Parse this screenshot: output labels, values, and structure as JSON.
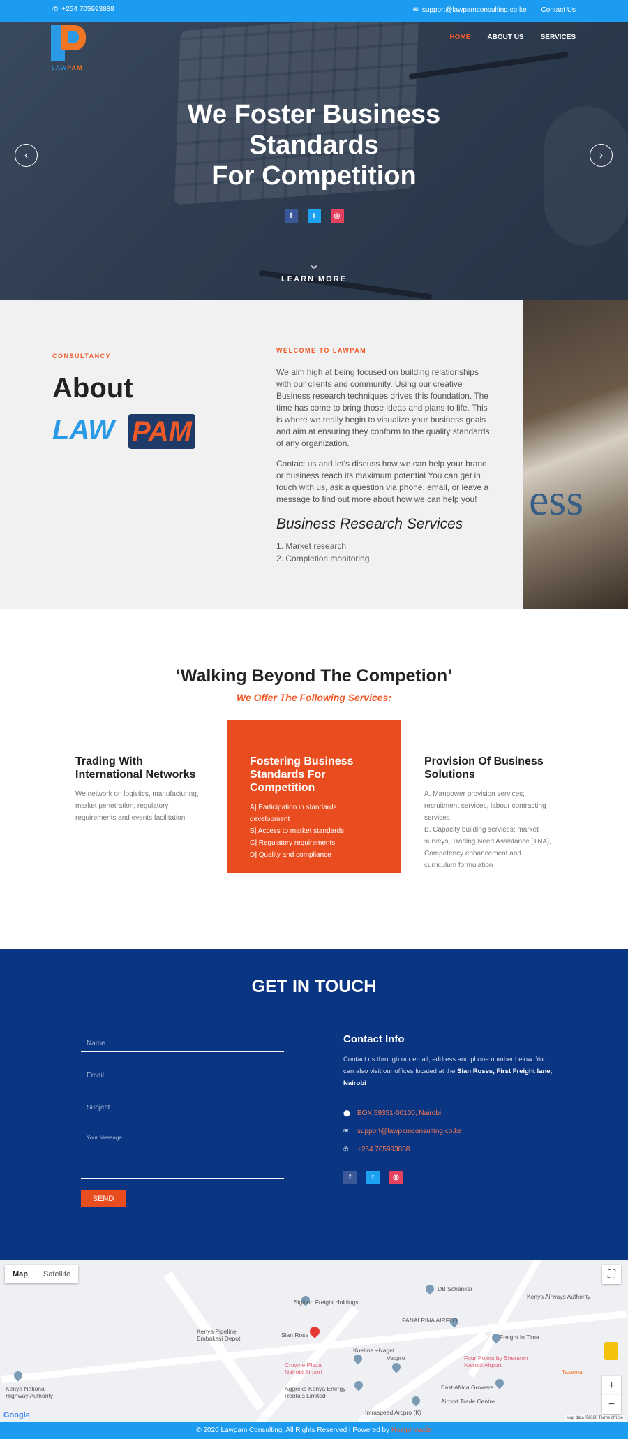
{
  "topbar": {
    "phone": "+254 705993888",
    "email": "support@lawpamconsulting.co.ke",
    "contact_link": "Contact Us"
  },
  "brand": {
    "logo_law": "LAW",
    "logo_pam": "PAM"
  },
  "nav": {
    "home": "HOME",
    "about": "ABOUT US",
    "services": "SERVICES"
  },
  "hero": {
    "title_line1": "We Foster Business",
    "title_line2": "Standards",
    "title_line3": "For Competition",
    "learn_more": "LEARN MORE"
  },
  "social": {
    "facebook": "f",
    "twitter": "t",
    "instagram": "◎"
  },
  "about": {
    "consultancy": "CONSULTANCY",
    "heading": "About",
    "law": "LAW",
    "pam": "PAM",
    "welcome": "WELCOME TO LAWPAM",
    "para1": "We aim high at being focused on building relationships with our clients and community. Using our creative Business research techniques drives this foundation. The time has come to bring those ideas and plans to life. This is where we really begin to visualize your business goals and aim at ensuring they conform to the quality standards of any organization.",
    "para2": "Contact us and let's discuss how we can help your brand or business reach its maximum potential You can get in touch with us, ask a question via phone, email, or leave a message to find out more about how we can help you!",
    "services_title": "Business Research Services",
    "list": [
      "1. Market research",
      "2. Completion monitoring"
    ]
  },
  "services": {
    "motto": "‘Walking Beyond The Competion’",
    "offer": "We Offer The Following Services:",
    "cards": [
      {
        "title": "Trading With International Networks",
        "lines": [
          "We network on logistics, manufacturing, market penetration, regulatory requirements and events facilitation"
        ]
      },
      {
        "title": "Fostering Business Standards For Competition",
        "lines": [
          "A] Participation in standards development",
          "B] Access to market standards",
          "C] Regulatory requirements",
          "D] Quality and compliance"
        ]
      },
      {
        "title": "Provision Of Business Solutions",
        "lines": [
          "A. Manpower provision services; recruitment services, labour contracting services",
          "B. Capacity building services; market surveys, Trading Need Assistance [TNA], Competency enhancement and curriculum formulation"
        ]
      }
    ]
  },
  "contact": {
    "title": "GET IN TOUCH",
    "name_placeholder": "Name",
    "email_placeholder": "Email",
    "subject_placeholder": "Subject",
    "message_placeholder": "Your Message",
    "send": "SEND",
    "info_title": "Contact Info",
    "info_text": "Contact us through our email, address and phone number below. You can also visit our offices located at the",
    "info_location": "Sian Roses, First Freight lane, Nairobi",
    "address": "BOX 59351-00100, Nairobi",
    "email": "support@lawpamconsulting.co.ke",
    "phone": "+254 705993888"
  },
  "map": {
    "tab_map": "Map",
    "tab_satellite": "Satellite",
    "labels": {
      "siginon": "Siginon Freight Holdings",
      "db": "DB Schenker",
      "kenya_authority": "Kenya Airways Authority",
      "pipeline": "Kenya Pipeline Embakasi Depot",
      "sianrose": "Sian Rose",
      "panalpina": "PANALPINA AIRFLO",
      "freight_in_time": "Freight In Time",
      "kuehne": "Kuehne +Nagel",
      "four_points": "Four Points by Sheraton Nairobi Airport",
      "crowne": "Crowne Plaza Nairobi Airport",
      "vecpro": "Vecpro",
      "tazama": "Tazama",
      "aggreko": "Aggreko Kenya Energy Rentals Limited",
      "east_africa": "East Africa Growers",
      "kenha": "Kenya National Highway Authority",
      "airport_trade": "Airport Trade Centre",
      "intraspeed": "Intraspeed Arcpro (K)"
    },
    "google": "Google",
    "map_data": "Map data ©2020   Terms of Use"
  },
  "footer": {
    "text": "© 2020 Lawpam Consulting. All Rights Reserved | Powered by",
    "powered": "Hostpinnacle"
  },
  "colors": {
    "brand_blue": "#1b9cf0",
    "accent_orange": "#e94c1e",
    "navy": "#0a3582"
  }
}
